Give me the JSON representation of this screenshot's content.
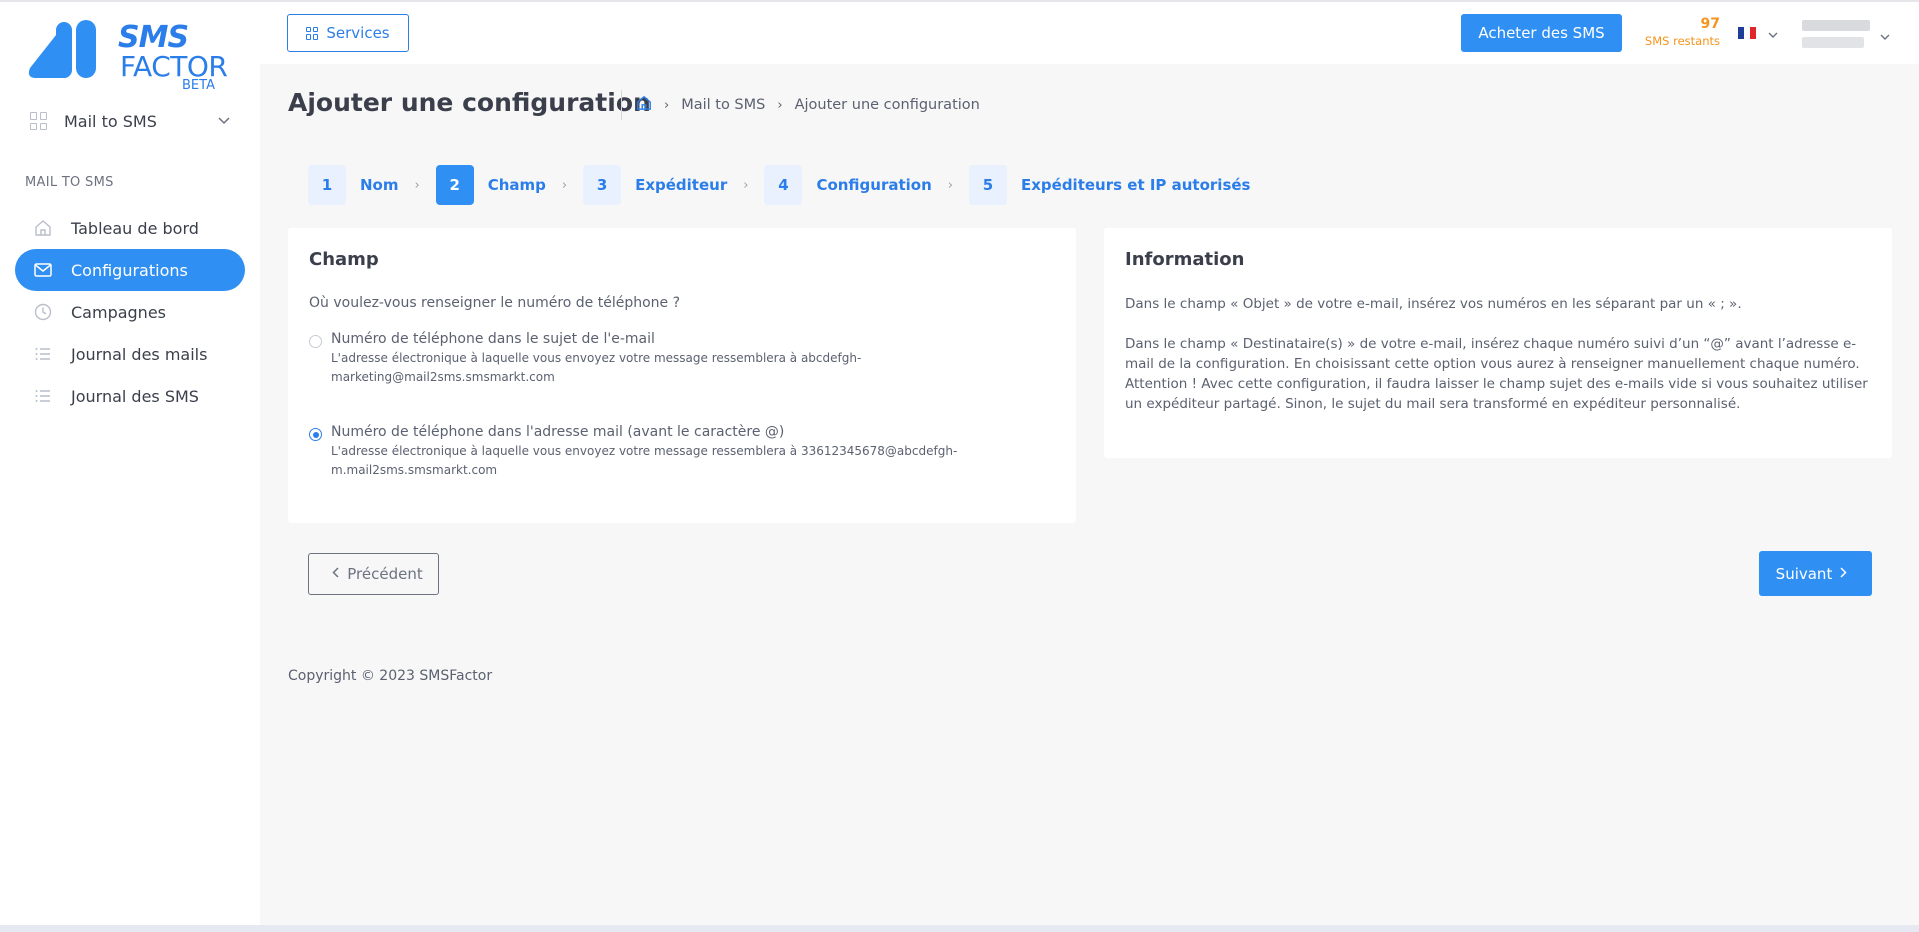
{
  "brand": {
    "name_line1": "SMS",
    "name_line2": "FACTOR",
    "badge": "BETA",
    "primary_color": "#2f8ff3",
    "accent_color": "#f5941e"
  },
  "sidebar": {
    "module_label": "Mail to SMS",
    "section_title": "MAIL TO SMS",
    "items": [
      {
        "label": "Tableau de bord",
        "icon": "home-icon",
        "active": false
      },
      {
        "label": "Configurations",
        "icon": "mail-icon",
        "active": true
      },
      {
        "label": "Campagnes",
        "icon": "clock-icon",
        "active": false
      },
      {
        "label": "Journal des mails",
        "icon": "list-icon",
        "active": false
      },
      {
        "label": "Journal des SMS",
        "icon": "list-icon",
        "active": false
      }
    ]
  },
  "header": {
    "services_label": "Services",
    "buy_label": "Acheter des SMS",
    "credits_value": "97",
    "credits_label": "SMS restants",
    "language_icon": "flag-fr-icon"
  },
  "page": {
    "title": "Ajouter une configuration",
    "breadcrumb": [
      "Mail to SMS",
      "Ajouter une configuration"
    ]
  },
  "stepper": [
    {
      "number": "1",
      "label": "Nom",
      "active": false
    },
    {
      "number": "2",
      "label": "Champ",
      "active": true
    },
    {
      "number": "3",
      "label": "Expéditeur",
      "active": false
    },
    {
      "number": "4",
      "label": "Configuration",
      "active": false
    },
    {
      "number": "5",
      "label": "Expéditeurs et IP autorisés",
      "active": false
    }
  ],
  "champ_card": {
    "title": "Champ",
    "question": "Où voulez-vous renseigner le numéro de téléphone ?",
    "options": [
      {
        "title": "Numéro de téléphone dans le sujet de l'e-mail",
        "description": "L'adresse électronique à laquelle vous envoyez votre message ressemblera à abcdefgh-marketing@mail2sms.smsmarkt.com",
        "checked": false
      },
      {
        "title": "Numéro de téléphone dans l'adresse mail (avant le caractère @)",
        "description": "L'adresse électronique à laquelle vous envoyez votre message ressemblera à 33612345678@abcdefgh-m.mail2sms.smsmarkt.com",
        "checked": true
      }
    ]
  },
  "info_card": {
    "title": "Information",
    "paragraph1": "Dans le champ « Objet » de votre e-mail, insérez vos numéros en les séparant par un « ; ».",
    "paragraph2": "Dans le champ « Destinataire(s) » de votre e-mail, insérez chaque numéro suivi d’un “@”  avant l’adresse e-mail de la configuration. En choisissant cette option vous aurez à renseigner manuellement chaque numéro. Attention ! Avec cette configuration, il faudra laisser le champ sujet des e-mails vide si vous souhaitez utiliser un expéditeur partagé. Sinon, le sujet du mail sera transformé en expéditeur personnalisé."
  },
  "actions": {
    "previous_label": "Précédent",
    "next_label": "Suivant"
  },
  "footer": {
    "copyright": "Copyright © 2023 SMSFactor"
  }
}
